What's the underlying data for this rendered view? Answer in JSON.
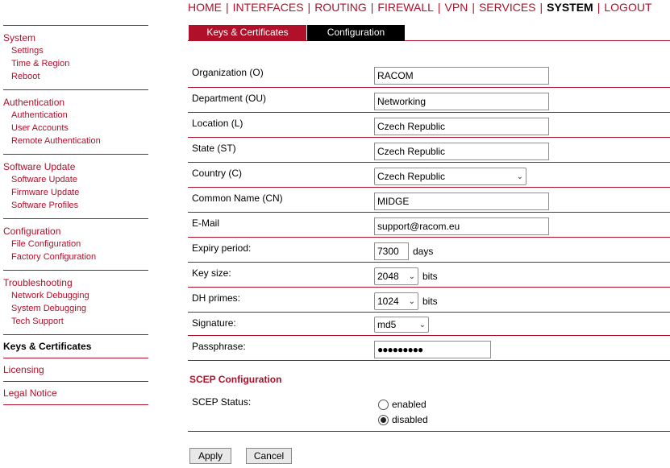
{
  "nav": {
    "items": [
      {
        "label": "HOME"
      },
      {
        "label": "INTERFACES"
      },
      {
        "label": "ROUTING"
      },
      {
        "label": "FIREWALL"
      },
      {
        "label": "VPN"
      },
      {
        "label": "SERVICES"
      },
      {
        "label": "SYSTEM"
      },
      {
        "label": "LOGOUT"
      }
    ],
    "separator": "|"
  },
  "sidebar": {
    "system": {
      "title": "System",
      "items": [
        "Settings",
        "Time & Region",
        "Reboot"
      ]
    },
    "authentication": {
      "title": "Authentication",
      "items": [
        "Authentication",
        "User Accounts",
        "Remote Authentication"
      ]
    },
    "software_update": {
      "title": "Software Update",
      "items": [
        "Software Update",
        "Firmware Update",
        "Software Profiles"
      ]
    },
    "configuration": {
      "title": "Configuration",
      "items": [
        "File Configuration",
        "Factory Configuration"
      ]
    },
    "troubleshooting": {
      "title": "Troubleshooting",
      "items": [
        "Network Debugging",
        "System Debugging",
        "Tech Support"
      ]
    },
    "keys": "Keys & Certificates",
    "licensing": "Licensing",
    "legal": "Legal Notice"
  },
  "tabs": {
    "keys": "Keys & Certificates",
    "config": "Configuration"
  },
  "form": {
    "organization": {
      "label": "Organization (O)",
      "value": "RACOM"
    },
    "department": {
      "label": "Department (OU)",
      "value": "Networking"
    },
    "location": {
      "label": "Location (L)",
      "value": "Czech Republic"
    },
    "state": {
      "label": "State (ST)",
      "value": "Czech Republic"
    },
    "country": {
      "label": "Country (C)",
      "value": "Czech Republic"
    },
    "common_name": {
      "label": "Common Name (CN)",
      "value": "MIDGE"
    },
    "email": {
      "label": "E-Mail",
      "value": "support@racom.eu"
    },
    "expiry": {
      "label": "Expiry period:",
      "value": "7300",
      "unit": "days"
    },
    "key_size": {
      "label": "Key size:",
      "value": "2048",
      "unit": "bits"
    },
    "dh_primes": {
      "label": "DH primes:",
      "value": "1024",
      "unit": "bits"
    },
    "signature": {
      "label": "Signature:",
      "value": "md5"
    },
    "passphrase": {
      "label": "Passphrase:",
      "value": "●●●●●●●●●"
    }
  },
  "scep": {
    "title": "SCEP Configuration",
    "status_label": "SCEP Status:",
    "options": {
      "enabled": "enabled",
      "disabled": "disabled"
    },
    "selected": "disabled"
  },
  "buttons": {
    "apply": "Apply",
    "cancel": "Cancel"
  },
  "colors": {
    "accent": "#b0102a"
  },
  "icons": {
    "dropdown": "chevron-down-icon",
    "radio": "radio-icon"
  }
}
